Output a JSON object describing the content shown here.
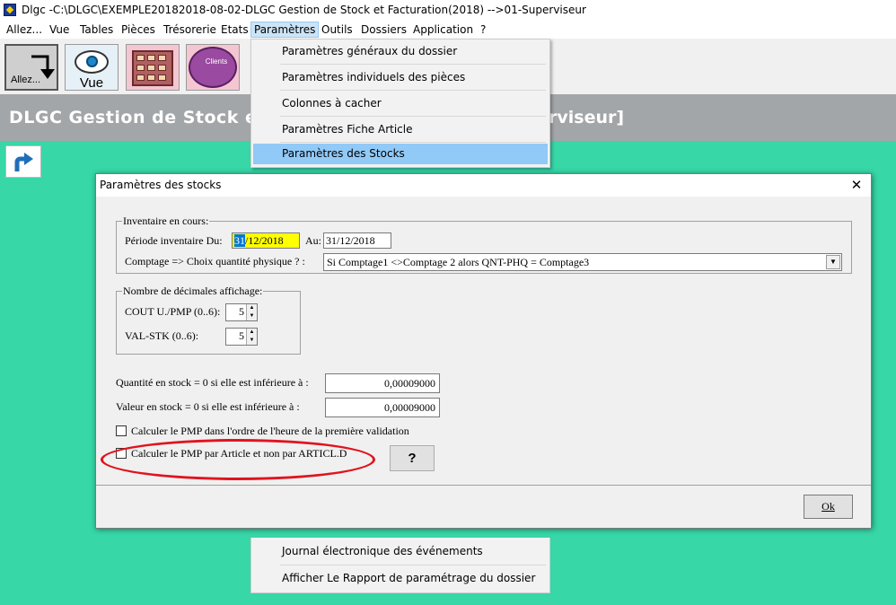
{
  "window": {
    "title": "Dlgc -C:\\DLGC\\EXEMPLE20182018-08-02-DLGC Gestion de Stock et Facturation(2018) -->01-Superviseur"
  },
  "menubar": {
    "items": [
      "Allez...",
      "Vue",
      "Tables",
      "Pièces",
      "Trésorerie",
      "Etats",
      "Paramètres",
      "Outils",
      "Dossiers",
      "Application",
      "?"
    ]
  },
  "toolbar": {
    "allez_label": "Allez...",
    "vue_label": "Vue",
    "clients_label": "Clients"
  },
  "header": {
    "title_left": "DLGC Gestion de Stock et F",
    "title_right": "rviseur]"
  },
  "params_menu": {
    "items": [
      "Paramètres généraux du dossier",
      "Paramètres individuels des pièces",
      "Colonnes à cacher",
      "Paramètres Fiche Article",
      "Paramètres des Stocks"
    ],
    "highlighted": "Paramètres des Stocks",
    "bottom_items": [
      "Journal électronique des événements",
      "Afficher Le Rapport de paramétrage du dossier"
    ]
  },
  "dialog": {
    "title": "Paramètres des stocks",
    "inventaire": {
      "legend": "Inventaire en cours:",
      "periode_label": "Période inventaire Du:",
      "du_sel": "31",
      "du_rest": "/12/2018",
      "au_label": "Au:",
      "au_value": "31/12/2018",
      "comptage_label": "Comptage => Choix quantité physique ? :",
      "comptage_value": "Si Comptage1 <>Comptage 2 alors QNT-PHQ = Comptage3"
    },
    "decimales": {
      "legend": "Nombre de décimales affichage:",
      "cout_label": "COUT U./PMP (0..6):",
      "cout_value": "5",
      "val_label": "VAL-STK (0..6):",
      "val_value": "5"
    },
    "quantite_label": "Quantité en stock = 0 si elle est inférieure à :",
    "quantite_value": "0,00009000",
    "valeur_label": "Valeur en stock  = 0 si elle est inférieure à :",
    "valeur_value": "0,00009000",
    "chk_pmp_ordre_label": "Calculer le PMP dans l'ordre de l'heure de la première validation",
    "chk_pmp_ordre": false,
    "chk_pmp_article_label": "Calculer le PMP par Article et non par ARTICL.D",
    "chk_pmp_article": false,
    "help_button": "?",
    "ok_button": "Ok"
  },
  "colors": {
    "workspace": "#37d7a8",
    "header_band": "#a3a6a8",
    "menu_highlight": "#91c9f7",
    "date_highlight": "#ffff00",
    "annotation_red": "#e0141e"
  }
}
